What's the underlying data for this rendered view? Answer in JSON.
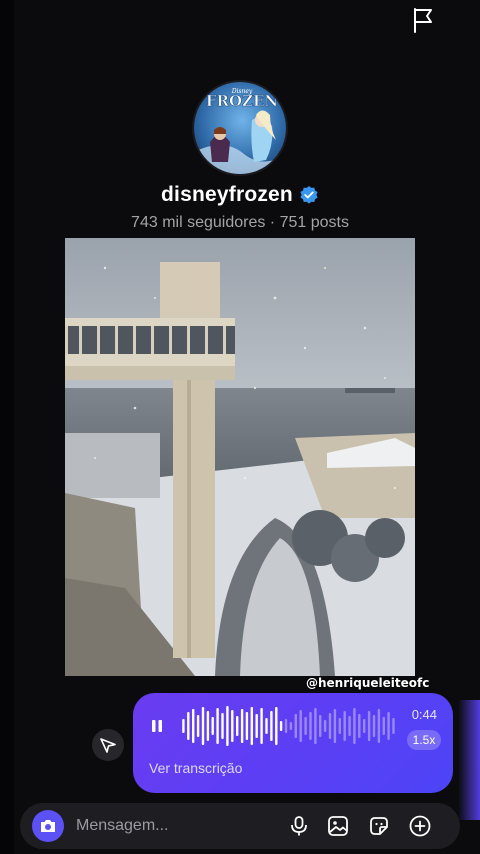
{
  "profile": {
    "avatar_logo_text": "FROZEN",
    "avatar_logo_small": "Disney",
    "username": "disneyfrozen",
    "verified": true,
    "subtitle": "743 mil seguidores · 751 posts"
  },
  "post": {
    "watermark": "@henriqueleiteofc"
  },
  "voice_message": {
    "duration": "0:44",
    "speed": "1.5x",
    "progress": 0.47,
    "transcript_label": "Ver transcrição"
  },
  "composer": {
    "placeholder": "Mensagem..."
  },
  "icons": {
    "top_right": "flag-icon",
    "share": "send-icon",
    "camera": "camera-icon",
    "mic": "microphone-icon",
    "gallery": "image-icon",
    "sticker": "sticker-icon",
    "more": "plus-icon"
  },
  "colors": {
    "accent": "#5b51f5",
    "bubble": "#6a3cf0",
    "verified": "#3897f0"
  }
}
